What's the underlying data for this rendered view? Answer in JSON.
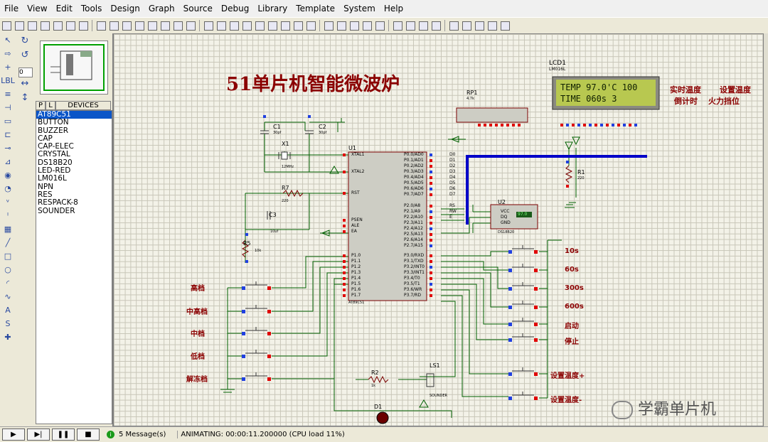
{
  "menu": [
    "File",
    "View",
    "Edit",
    "Tools",
    "Design",
    "Graph",
    "Source",
    "Debug",
    "Library",
    "Template",
    "System",
    "Help"
  ],
  "toolbar_icons": [
    "new-icon",
    "open-icon",
    "save-icon",
    "import-icon",
    "export-icon",
    "print-icon",
    "print-area-icon",
    "refresh-icon",
    "grid-icon",
    "origin-icon",
    "pan-icon",
    "zoom-in-icon",
    "zoom-out-icon",
    "zoom-all-icon",
    "zoom-area-icon",
    "undo-icon",
    "redo-icon",
    "cut-icon",
    "copy-icon",
    "paste-icon",
    "block-copy-icon",
    "block-move-icon",
    "block-rotate-icon",
    "block-delete-icon",
    "pick-icon",
    "make-device-icon",
    "packaging-icon",
    "decompose-icon",
    "wire-autorouter-icon",
    "search-icon",
    "property-assign-icon",
    "design-explorer-icon",
    "new-sheet-icon",
    "remove-sheet-icon",
    "exit-to-parent-icon",
    "bom-icon",
    "erc-icon",
    "netlist-icon"
  ],
  "left_tools": [
    "select-icon",
    "component-icon",
    "junction-icon",
    "wire-label-icon",
    "text-script-icon",
    "bus-icon",
    "subcircuit-icon",
    "terminal-icon",
    "pin-icon",
    "graph-icon",
    "tape-icon",
    "generator-icon",
    "probe-voltage-icon",
    "probe-current-icon",
    "virtual-instrument-icon",
    "line-icon",
    "box-icon",
    "circle-icon",
    "arc-icon",
    "path-icon",
    "text-icon",
    "symbol-icon",
    "marker-icon"
  ],
  "left_tool_glyphs": [
    "↖",
    "⇨",
    "+",
    "LBL",
    "≡",
    "⊣",
    "▭",
    "⊏",
    "⊸",
    "⊿",
    "◉",
    "◔",
    "ᵛ",
    "ᴵ",
    "▦",
    "╱",
    "□",
    "○",
    "◜",
    "∿",
    "A",
    "S",
    "✚"
  ],
  "side_tools": {
    "rotate_cw": "↻",
    "rotate_ccw": "↺",
    "mirror_x": "↔",
    "mirror_y": "↕"
  },
  "zoom_value": "0",
  "devices": {
    "tab_p": "P",
    "tab_l": "L",
    "header": "DEVICES",
    "items": [
      "AT89C51",
      "BUTTON",
      "BUZZER",
      "CAP",
      "CAP-ELEC",
      "CRYSTAL",
      "DS18B20",
      "LED-RED",
      "LM016L",
      "NPN",
      "RES",
      "RESPACK-8",
      "SOUNDER"
    ],
    "selected_index": 0
  },
  "schematic": {
    "title": "51单片机智能微波炉",
    "lcd_ref": "LCD1",
    "lcd_part": "LM016L",
    "lcd_line1": "TEMP 97.0'C 100",
    "lcd_line2": "TIME 060s  3",
    "label_realtime_temp": "实时温度",
    "label_set_temp": "设置温度",
    "label_countdown": "倒计时",
    "label_power": "火力挡位",
    "rp1": "RP1",
    "rp1_val": "4.7k",
    "c1": "C1",
    "c1_val": "30pf",
    "c2": "C2",
    "c2_val": "30pf",
    "x1": "X1",
    "x1_val": "12MHz",
    "c3": "C3",
    "c3_val": "10uf",
    "r7": "R7",
    "r7_val": "220",
    "r5": "R5",
    "r5_val": "10k",
    "r1": "R1",
    "r1_val": "220",
    "r2": "R2",
    "r2_val": "1k",
    "u1": "U1",
    "u1_part": "AT89C51",
    "u2": "U2",
    "u2_part": "DS18B20",
    "u2_display": "97.0",
    "u2_pins": [
      "VCC",
      "DQ",
      "GND"
    ],
    "ls1": "LS1",
    "ls1_part": "SOUNDER",
    "d1": "D1",
    "u1_left_pins": [
      "XTAL1",
      "XTAL2",
      "RST",
      "PSEN",
      "ALE",
      "EA",
      "P1.0",
      "P1.1",
      "P1.2",
      "P1.3",
      "P1.4",
      "P1.5",
      "P1.6",
      "P1.7"
    ],
    "u1_right_pins": [
      "P0.0/AD0",
      "P0.1/AD1",
      "P0.2/AD2",
      "P0.3/AD3",
      "P0.4/AD4",
      "P0.5/AD5",
      "P0.6/AD6",
      "P0.7/AD7",
      "P2.0/A8",
      "P2.1/A9",
      "P2.2/A10",
      "P2.3/A11",
      "P2.4/A12",
      "P2.5/A13",
      "P2.6/A14",
      "P2.7/A15",
      "P3.0/RXD",
      "P3.1/TXD",
      "P3.2/INT0",
      "P3.3/INT1",
      "P3.4/T0",
      "P3.5/T1",
      "P3.6/WR",
      "P3.7/RD"
    ],
    "bus_labels": [
      "D0",
      "D1",
      "D2",
      "D3",
      "D4",
      "D5",
      "D6",
      "D7",
      "RS",
      "RW",
      "E"
    ],
    "left_buttons": [
      "高档",
      "中高档",
      "中档",
      "低档",
      "解冻档"
    ],
    "right_buttons": [
      "10s",
      "60s",
      "300s",
      "600s",
      "启动",
      "停止",
      "设置温度+",
      "设置温度-"
    ],
    "watermark": "学霸单片机"
  },
  "status": {
    "messages": "5 Message(s)",
    "animating": "ANIMATING: 00:00:11.200000 (CPU load 11%)"
  },
  "colors": {
    "dark_red": "#8b0000",
    "wire": "#006000",
    "bus": "#0000c8",
    "lcd_bg": "#b8c850",
    "pin_red": "#e00000",
    "pin_blue": "#2040e0"
  }
}
